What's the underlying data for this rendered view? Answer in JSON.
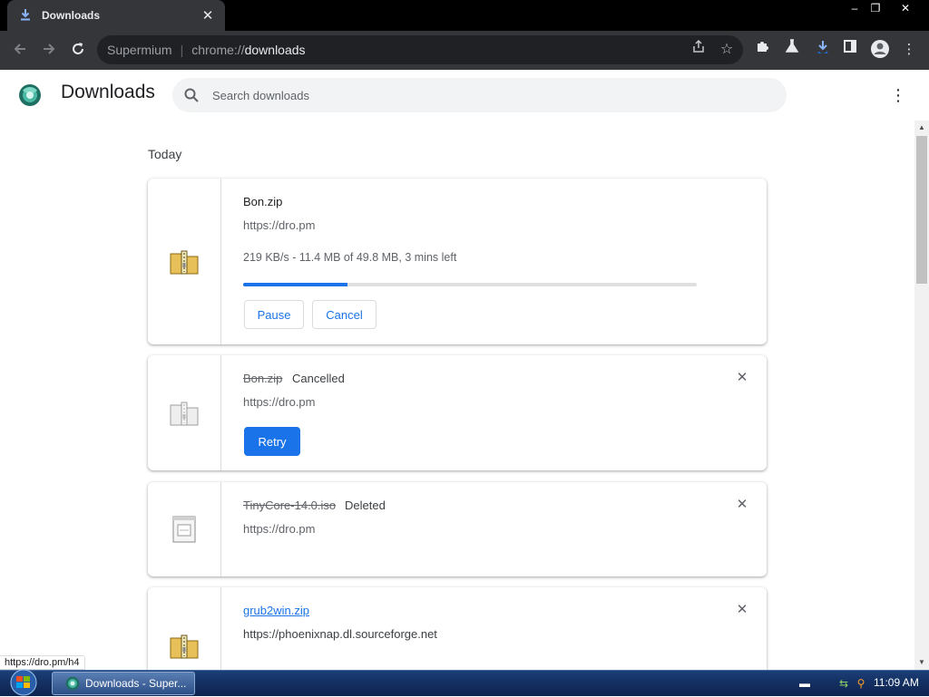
{
  "colors": {
    "accent": "#1a73e8",
    "titlebar": "#000000",
    "toolbar": "#35363a",
    "omnibox": "#202124"
  },
  "tab": {
    "title": "Downloads",
    "icon": "download-icon"
  },
  "window_controls": {
    "minimize": "–",
    "restore": "❐",
    "close": "✕"
  },
  "toolbar": {
    "site_label": "Supermium",
    "separator": "|",
    "url_scheme": "chrome://",
    "url_host": "downloads"
  },
  "header": {
    "title": "Downloads",
    "search_placeholder": "Search downloads"
  },
  "section": {
    "label": "Today"
  },
  "downloads": [
    {
      "name": "Bon.zip",
      "url": "https://dro.pm",
      "description": "219 KB/s - 11.4 MB of 49.8 MB, 3 mins left",
      "progress_percent": 23,
      "buttons": {
        "pause": "Pause",
        "cancel": "Cancel"
      },
      "icon": "zip-folder-icon"
    },
    {
      "name": "Bon.zip",
      "status": "Cancelled",
      "url": "https://dro.pm",
      "buttons": {
        "retry": "Retry"
      },
      "icon": "zip-folder-icon"
    },
    {
      "name": "TinyCore-14.0.iso",
      "status": "Deleted",
      "url": "https://dro.pm",
      "icon": "disc-image-file-icon"
    },
    {
      "name": "grub2win.zip",
      "url": "https://phoenixnap.dl.sourceforge.net",
      "icon": "zip-folder-icon"
    }
  ],
  "status_bubble": "https://dro.pm/h4",
  "taskbar": {
    "task_label": "Downloads - Super...",
    "clock": "11:09 AM"
  }
}
